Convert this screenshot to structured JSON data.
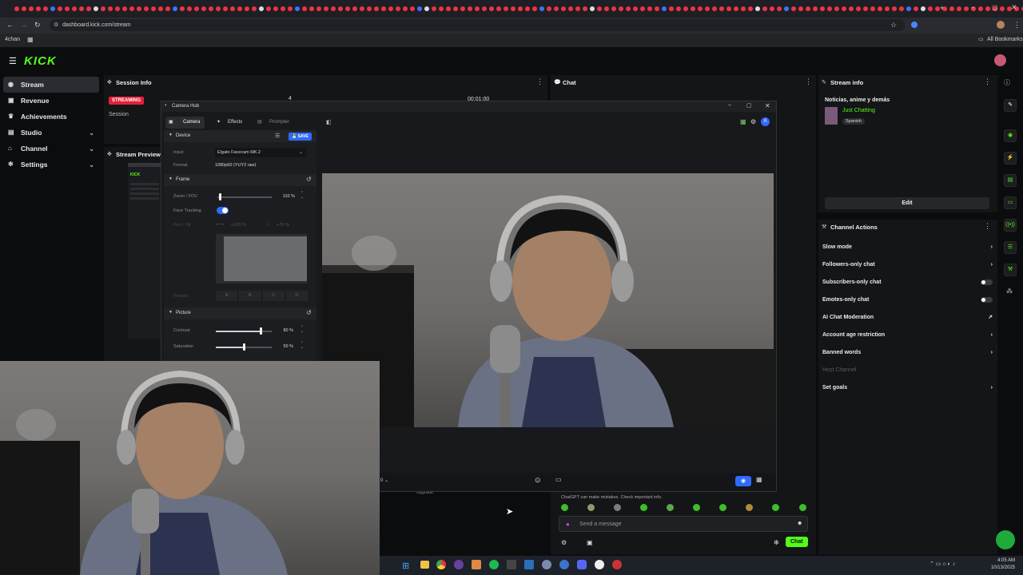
{
  "browser": {
    "url": "dashboard.kick.com/stream",
    "bookmark_site": "4chan",
    "all_bookmarks": "All Bookmarks"
  },
  "sidebar": {
    "items": [
      {
        "label": "Stream",
        "icon": "broadcast-icon",
        "active": true
      },
      {
        "label": "Revenue",
        "icon": "revenue-icon"
      },
      {
        "label": "Achievements",
        "icon": "trophy-icon"
      },
      {
        "label": "Studio",
        "icon": "studio-icon",
        "chevron": true
      },
      {
        "label": "Channel",
        "icon": "channel-icon",
        "chevron": true
      },
      {
        "label": "Settings",
        "icon": "gear-icon",
        "chevron": true
      }
    ]
  },
  "session_info": {
    "title": "Session Info",
    "status_badge": "STREAMING",
    "session_label": "Session",
    "timer": "00:01:00",
    "count": "4"
  },
  "stream_preview": {
    "title": "Stream Preview"
  },
  "chat": {
    "title": "Chat",
    "notice": "ChatGPT can make mistakes. Check important info.",
    "upgrade": "Upgrade",
    "input_placeholder": "Send a message",
    "send_label": "Chat"
  },
  "stream_info": {
    "title": "Stream info",
    "stream_title": "Noticias, anime y demás",
    "category": "Just Chatting",
    "language": "Spanish",
    "edit_label": "Edit"
  },
  "channel_actions": {
    "title": "Channel Actions",
    "rows": [
      {
        "label": "Slow mode",
        "control": "chevron"
      },
      {
        "label": "Followers-only chat",
        "control": "chevron"
      },
      {
        "label": "Subscribers-only chat",
        "control": "toggle"
      },
      {
        "label": "Emotes-only chat",
        "control": "toggle"
      },
      {
        "label": "AI Chat Moderation",
        "control": "external"
      },
      {
        "label": "Account age restriction",
        "control": "chevron"
      },
      {
        "label": "Banned words",
        "control": "chevron"
      },
      {
        "label": "Host Channel",
        "control": "none",
        "disabled": true
      },
      {
        "label": "Set goals",
        "control": "chevron"
      }
    ]
  },
  "camera_hub": {
    "window_title": "Camera Hub",
    "tabs": [
      "Camera",
      "Effects",
      "Prompter"
    ],
    "device": {
      "section": "Device",
      "save_label": "SAVE",
      "input_label": "Input",
      "input_value": "Elgato Facecam MK.2",
      "format_label": "Format",
      "format_value": "1080p60 (YUY2 raw)"
    },
    "frame": {
      "section": "Frame",
      "zoom_label": "Zoom / FOV",
      "zoom_value": "110 %",
      "zoom_level": 0.05,
      "face_tracking_label": "Face Tracking",
      "face_tracking_on": true,
      "pan_label": "Pan / Tilt",
      "pan_x": "+100 %",
      "pan_y": "+76 %",
      "presets_label": "Presets",
      "presets": [
        "A",
        "B",
        "C",
        "D"
      ]
    },
    "picture": {
      "section": "Picture",
      "contrast_label": "Contrast",
      "contrast_value": "80 %",
      "contrast_level": 0.8,
      "saturation_label": "Saturation",
      "saturation_value": "50 %",
      "saturation_level": 0.5
    },
    "zoom_dropdown": "0"
  },
  "taskbar": {
    "time": "4:05 AM",
    "date": "10/13/2025"
  },
  "colors": {
    "kick_green": "#53fc18",
    "streaming_red": "#e5213a",
    "save_blue": "#2f6bff",
    "toggle_blue": "#2f6bff"
  }
}
